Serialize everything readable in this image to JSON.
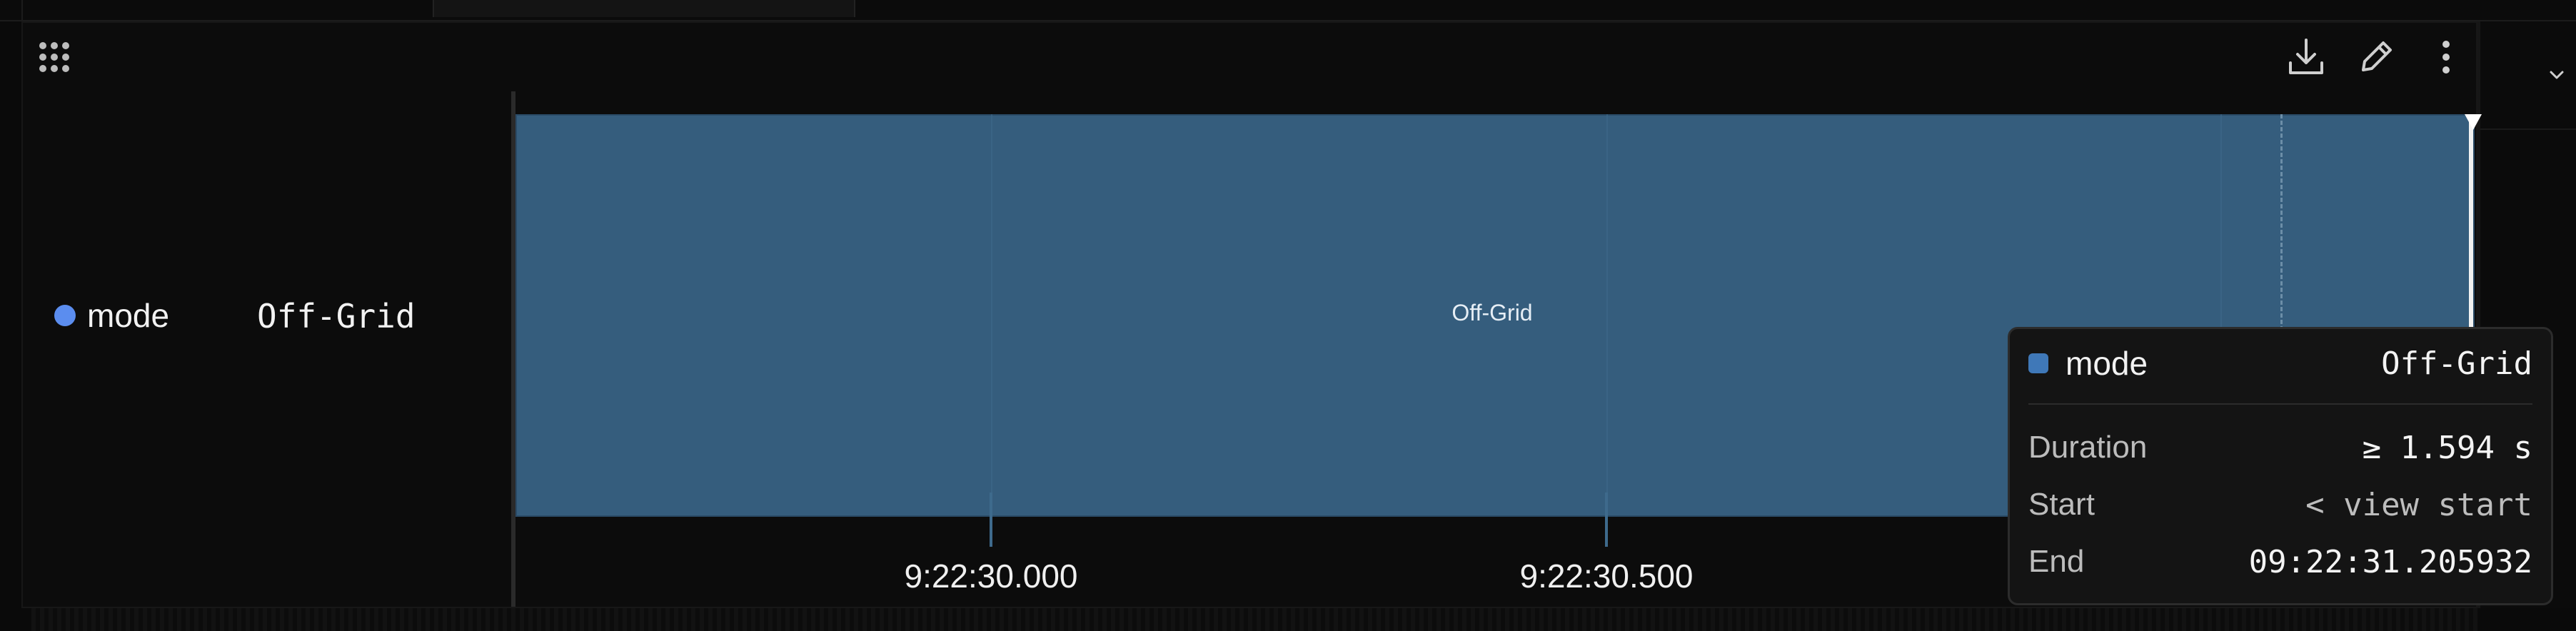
{
  "toolbar": {
    "icons": [
      "drag-handle-icon",
      "download-icon",
      "edit-icon",
      "more-vertical-icon",
      "chevron-down-icon"
    ]
  },
  "legend": {
    "series_name": "mode",
    "current_value": "Off-Grid",
    "dot_color": "#5b8def"
  },
  "chart_data": {
    "type": "timeline",
    "series": [
      {
        "name": "mode",
        "color": "#355d7d",
        "segments": [
          {
            "label": "Off-Grid",
            "end": "09:22:31.205932"
          }
        ]
      }
    ],
    "x_ticks": [
      "9:22:30.000",
      "9:22:30.500"
    ]
  },
  "tooltip": {
    "series_name": "mode",
    "series_value": "Off-Grid",
    "series_color": "#3f78b8",
    "rows": [
      {
        "key": "Duration",
        "value": "≥ 1.594 s"
      },
      {
        "key": "Start",
        "value": "< view start"
      },
      {
        "key": "End",
        "value": "09:22:31.205932"
      }
    ]
  },
  "colors": {
    "background": "#0a0a0a",
    "bar": "#355d7d",
    "tooltip_bg": "#141414"
  }
}
